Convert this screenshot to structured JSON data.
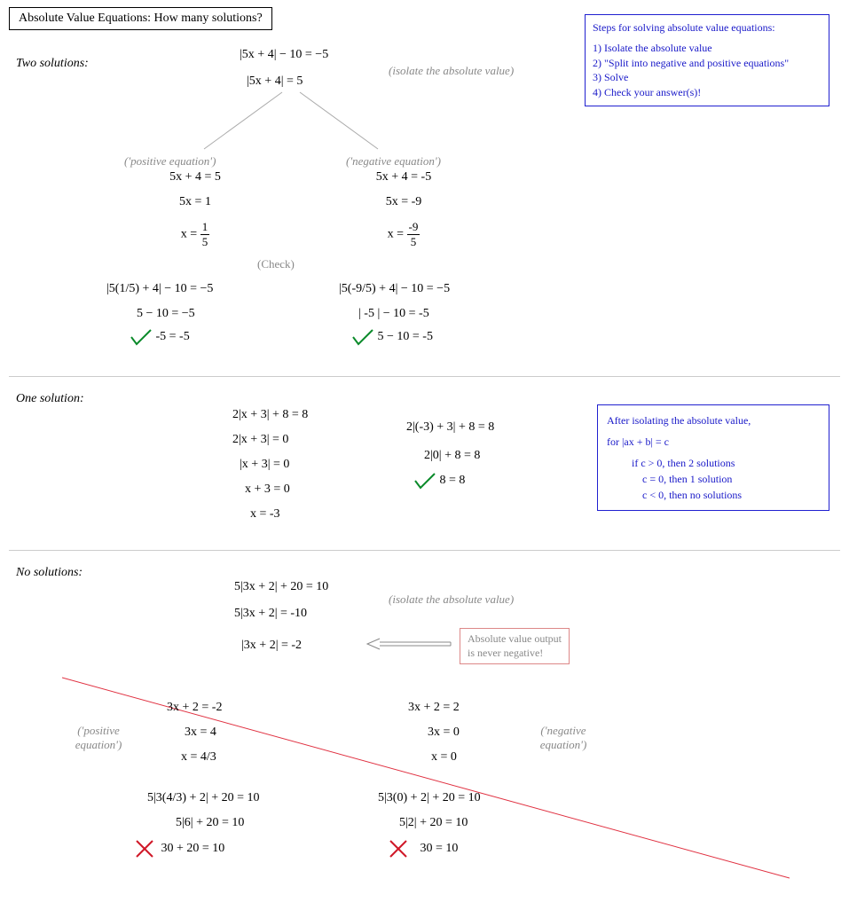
{
  "title": "Absolute Value Equations:  How many solutions?",
  "steps_box": {
    "heading": "Steps for solving absolute value equations:",
    "s1": "1) Isolate the absolute value",
    "s2": "2) \"Split into negative and positive equations\"",
    "s3": "3) Solve",
    "s4": "4) Check your answer(s)!"
  },
  "sec1": {
    "label": "Two solutions:",
    "eq1": "|5x + 4| − 10 = −5",
    "eq2": "|5x + 4|  =  5",
    "hint": "(isolate the absolute value)",
    "pos_label": "('positive equation')",
    "neg_label": "('negative equation')",
    "pos1": "5x + 4 = 5",
    "pos2": "5x = 1",
    "pos3_pre": "x = ",
    "pos3_num": "1",
    "pos3_den": "5",
    "neg1": "5x + 4 = -5",
    "neg2": "5x = -9",
    "neg3_pre": "x = ",
    "neg3_num": "-9",
    "neg3_den": "5",
    "check_label": "(Check)",
    "chk_pos1": "|5(1/5) + 4| − 10 = −5",
    "chk_pos2": "5   −  10  = −5",
    "chk_pos3": "-5  =  -5",
    "chk_neg1": "|5(-9/5) + 4| − 10 = −5",
    "chk_neg2": "| -5 |  −  10  =  -5",
    "chk_neg3": "5  −  10  = -5"
  },
  "sec2": {
    "label": "One solution:",
    "eq1": "2|x + 3| + 8 = 8",
    "eq2": "2|x + 3|  =  0",
    "eq3": "|x + 3| =  0",
    "eq4": "x + 3 = 0",
    "eq5": "x = -3",
    "chk1": "2|(-3) + 3| + 8 = 8",
    "chk2": "2|0| + 8 = 8",
    "chk3": "8  =  8",
    "note": {
      "l1": "After isolating the absolute value,",
      "l2": "for   |ax + b| = c",
      "l3": "if  c > 0,  then 2 solutions",
      "l4": "c = 0,  then 1 solution",
      "l5": "c < 0,  then no solutions"
    }
  },
  "sec3": {
    "label": "No solutions:",
    "eq1": "5|3x + 2| + 20 = 10",
    "eq2": "5|3x + 2|  =  -10",
    "eq3": "|3x + 2|  =  -2",
    "hint": "(isolate the absolute value)",
    "callout1": "Absolute value output",
    "callout2": "is never negative!",
    "pos_label": "('positive equation')",
    "neg_label": "('negative equation')",
    "pos1": "3x + 2 = -2",
    "pos2": "3x = 4",
    "pos3": "x = 4/3",
    "neg1": "3x + 2  =  2",
    "neg2": "3x = 0",
    "neg3": "x = 0",
    "chk_pos1": "5|3(4/3) + 2| + 20 = 10",
    "chk_pos2": "5|6| + 20 = 10",
    "chk_pos3": "30 + 20 = 10",
    "chk_neg1": "5|3(0) + 2| + 20 = 10",
    "chk_neg2": "5|2|  + 20 = 10",
    "chk_neg3": "30 =  10"
  }
}
